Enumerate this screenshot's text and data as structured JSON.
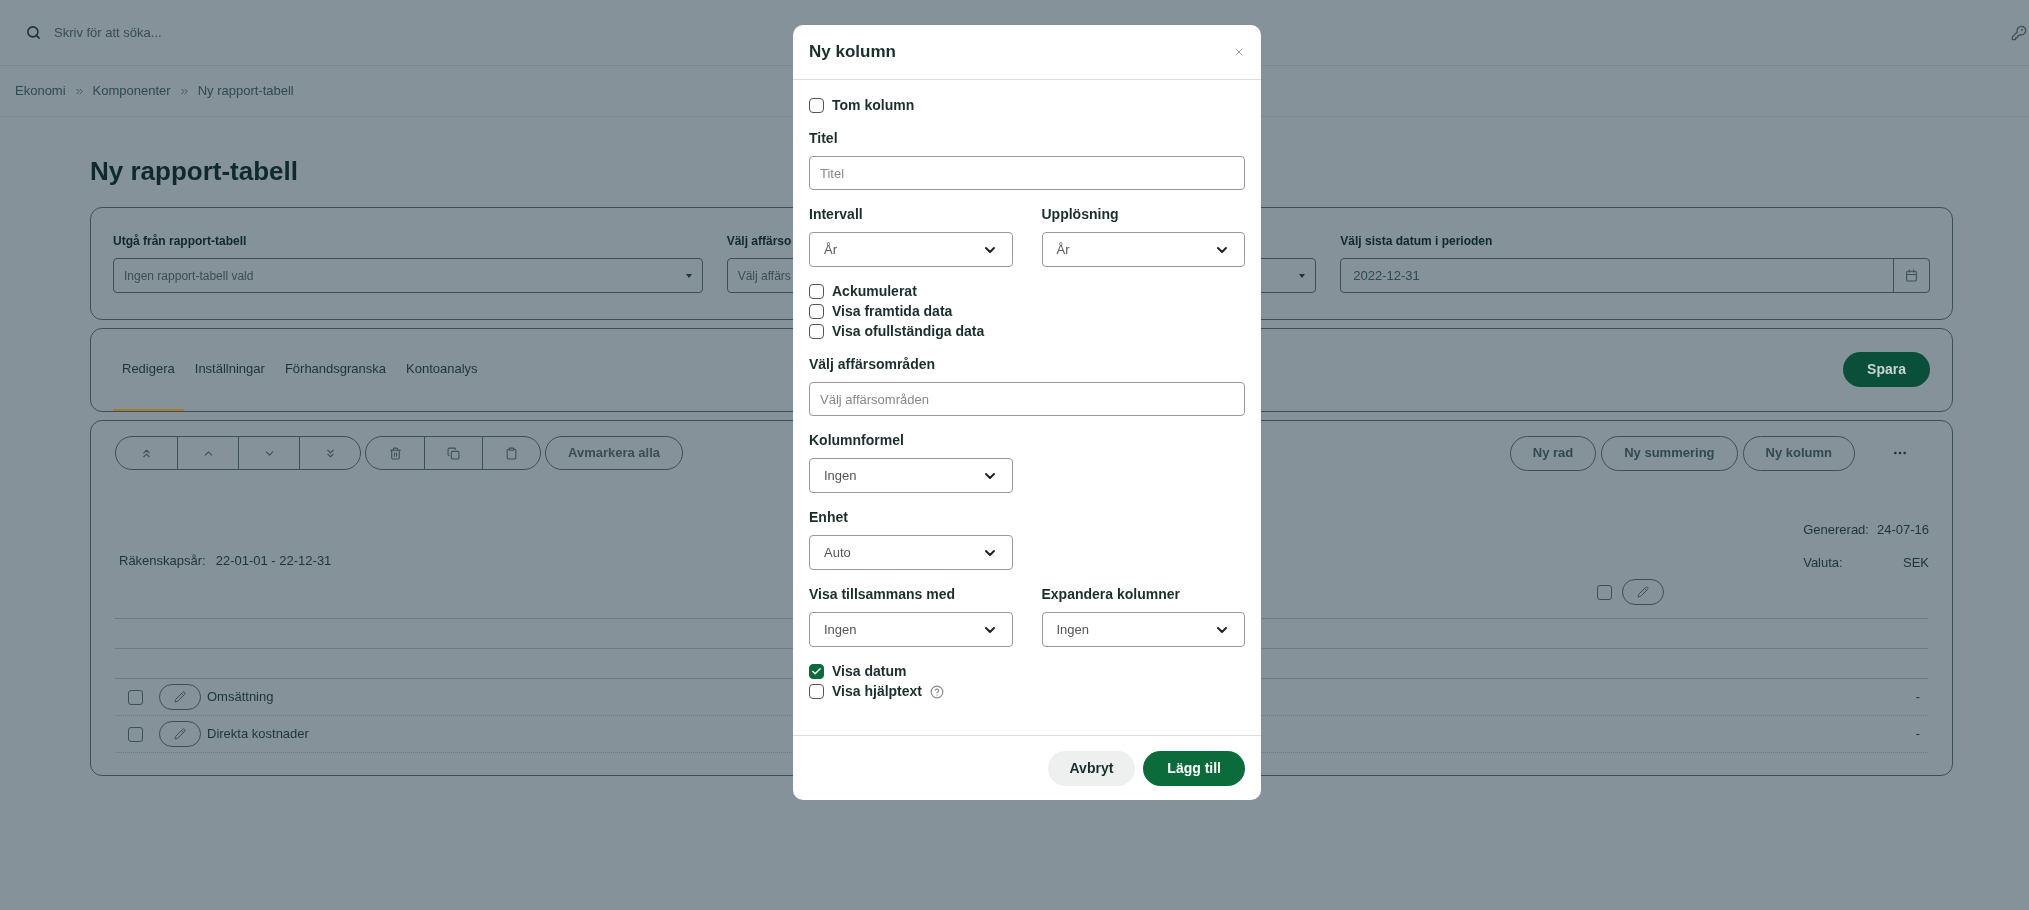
{
  "search": {
    "placeholder": "Skriv för att söka..."
  },
  "breadcrumb": [
    "Ekonomi",
    "Komponenter",
    "Ny rapport-tabell"
  ],
  "page_title": "Ny rapport-tabell",
  "filters": [
    {
      "kind": "select",
      "label": "Utgå från rapport-tabell",
      "placeholder": "Ingen rapport-tabell vald"
    },
    {
      "kind": "select",
      "label": "Välj affärso",
      "placeholder": "Välj affärs"
    },
    {
      "kind": "date",
      "label": "Välj sista datum i perioden",
      "value": "2022-12-31"
    }
  ],
  "tabs": [
    {
      "label": "Redigera",
      "selected": true
    },
    {
      "label": "Inställningar",
      "selected": false
    },
    {
      "label": "Förhandsgranska",
      "selected": false
    },
    {
      "label": "Kontoanalys",
      "selected": false
    }
  ],
  "save_button": "Spara",
  "deselect_button": "Avmarkera alla",
  "action_buttons": [
    "Ny rad",
    "Ny summering",
    "Ny kolumn"
  ],
  "report": {
    "fiscal_year_label": "Räkenskapsår:",
    "fiscal_year": "22-01-01 - 22-12-31",
    "generated_label": "Genererad:",
    "generated": "24-07-16",
    "currency_label": "Valuta:",
    "currency": "SEK",
    "column_checked": false,
    "rows": [
      {
        "name": "Omsättning",
        "checked": false,
        "value": "-"
      },
      {
        "name": "Direkta kostnader",
        "checked": false,
        "value": "-"
      }
    ]
  },
  "modal": {
    "title": "Ny kolumn",
    "fields": [
      {
        "kind": "checkboxes",
        "items": [
          {
            "label": "Tom kolumn",
            "checked": false
          }
        ]
      },
      {
        "kind": "text",
        "label": "Titel",
        "placeholder": "Titel"
      },
      {
        "kind": "selects",
        "items": [
          {
            "label": "Intervall",
            "value": "År"
          },
          {
            "label": "Upplösning",
            "value": "År"
          }
        ]
      },
      {
        "kind": "checkboxes",
        "items": [
          {
            "label": "Ackumulerat",
            "checked": false
          },
          {
            "label": "Visa framtida data",
            "checked": false
          },
          {
            "label": "Visa ofullständiga data",
            "checked": false
          }
        ]
      },
      {
        "kind": "text",
        "label": "Välj affärsområden",
        "placeholder": "Välj affärsområden"
      },
      {
        "kind": "selects",
        "items": [
          {
            "label": "Kolumnformel",
            "value": "Ingen"
          }
        ]
      },
      {
        "kind": "selects",
        "items": [
          {
            "label": "Enhet",
            "value": "Auto"
          }
        ]
      },
      {
        "kind": "selects",
        "items": [
          {
            "label": "Visa tillsammans med",
            "value": "Ingen"
          },
          {
            "label": "Expandera kolumner",
            "value": "Ingen"
          }
        ]
      },
      {
        "kind": "checkboxes",
        "items": [
          {
            "label": "Visa datum",
            "checked": true,
            "help": false
          },
          {
            "label": "Visa hjälptext",
            "checked": false,
            "help": true
          }
        ]
      }
    ],
    "buttons": [
      {
        "kind": "secondary",
        "label": "Avbryt"
      },
      {
        "kind": "primary",
        "label": "Lägg till"
      }
    ]
  }
}
